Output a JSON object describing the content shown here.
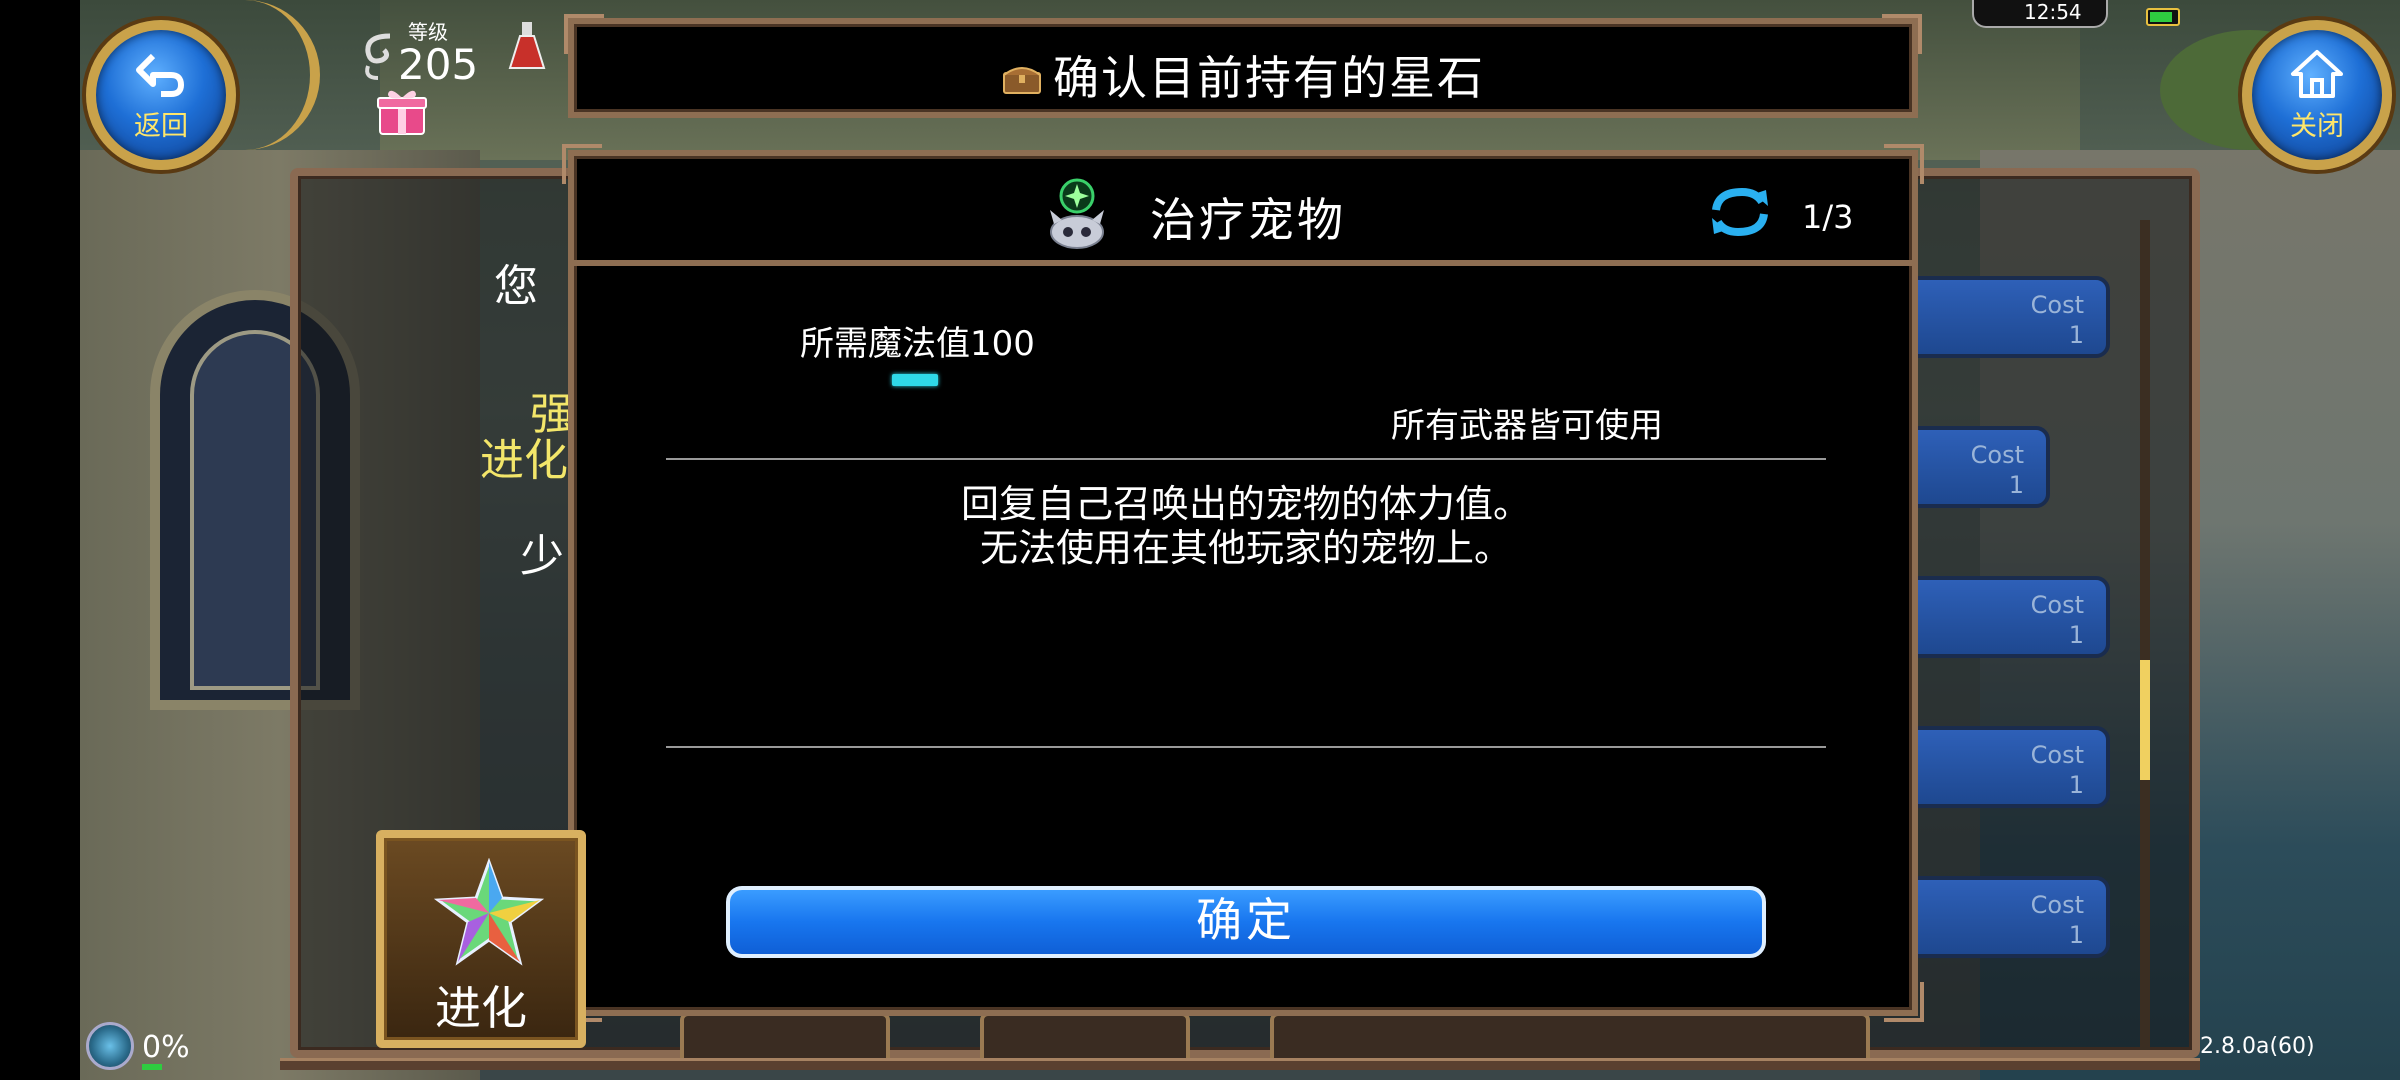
{
  "hud": {
    "back_label": "返回",
    "close_label": "关闭",
    "level_label": "等级",
    "level_value": "205",
    "status_time": "12:54",
    "network_percent": "0%",
    "version": "2.8.0a(60)"
  },
  "header": {
    "title": "确认目前持有的星石"
  },
  "dialog": {
    "skill_name": "治疗宠物",
    "page_indicator": "1/3",
    "mp_cost": "所需魔法值100",
    "weapon_requirement": "所有武器皆可使用",
    "description_line1": "回复自己召唤出的宠物的体力值。",
    "description_line2": "无法使用在其他玩家的宠物上。",
    "confirm_label": "确定"
  },
  "background_panel": {
    "text_partial_1": "您",
    "text_partial_2": "强",
    "text_partial_3": "进化",
    "text_partial_4": "少",
    "cost_buttons": [
      {
        "label": "Cost",
        "value": "1"
      },
      {
        "label": "Cost",
        "value": "1"
      },
      {
        "label": "Cost",
        "value": "1"
      },
      {
        "label": "Cost",
        "value": "1"
      },
      {
        "label": "Cost",
        "value": "1"
      }
    ],
    "evolve_label": "进化"
  },
  "colors": {
    "confirm_button": "#1876ef",
    "frame_border": "#8e6e52",
    "hud_gold": "#c9a24a",
    "mp_bar": "#2fd8e8"
  }
}
